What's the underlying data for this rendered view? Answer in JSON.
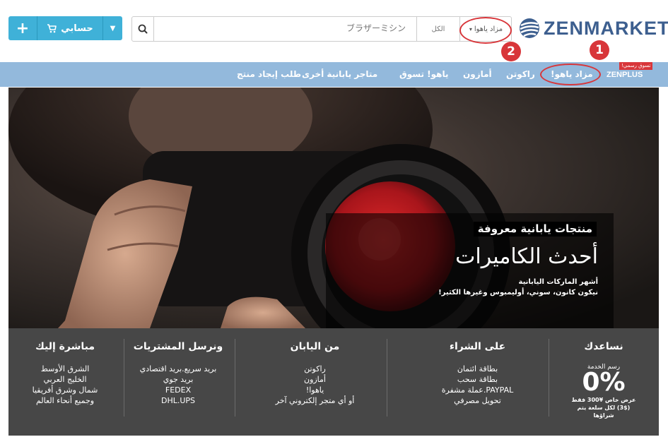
{
  "brand": {
    "name": "ZENMARKET"
  },
  "search": {
    "placeholder": "ブラザーミシン",
    "category": "الكل",
    "site": "مزاد ياهوا",
    "search_icon": "search-icon"
  },
  "account": {
    "label": "حسابي",
    "plus": "+",
    "cart_icon": "cart-icon",
    "caret_icon": "caret-down-icon"
  },
  "annotations": {
    "one": "1",
    "two": "2"
  },
  "nav": {
    "zenplus": "ZENPLUS",
    "zenplus_badge": "تسوق رسمي!",
    "items": [
      "مزاد ياهو!",
      "راكوتن",
      "أمازون",
      "ياهو! تسوق",
      "متاجر يابانية أخرى",
      "طلب إيجاد منتج"
    ]
  },
  "hero": {
    "subtitle": "منتجات يابانية معروفة",
    "title": "أحدث الكاميرات",
    "desc_line1": "أشهر الماركات اليابانية",
    "desc_line2": "نيكون كانون، سوني، أوليمبوس وغيرها الكثير!"
  },
  "footer": {
    "help": {
      "title": "نساعدك",
      "fee_label": "رسم الخدمة",
      "fee_value": "0%",
      "fee_desc": "عرض خاص ¥300 فقط ($3) لكل سلعة يتم شراؤها"
    },
    "buy": {
      "title": "على الشراء",
      "lines": [
        "بطاقة ائتمان",
        "بطاقة سحب",
        "PAYPAL.عملة مشفرة",
        "تحويل مصرفي"
      ]
    },
    "from_japan": {
      "title": "من اليابان",
      "lines": [
        "راكوتن",
        "أمازون",
        "ياهوا!",
        "أو أي متجر إلكتروني آخر"
      ]
    },
    "ship": {
      "title": "ونرسل المشتريات",
      "lines": [
        "بريد سريع.بريد اقتصادي",
        "بريد جوي",
        "FEDEX",
        "DHL.UPS"
      ]
    },
    "direct": {
      "title": "مباشرة إليك",
      "lines": [
        "الشرق الأوسط",
        "الخليج العربي",
        "شمال وشرق أفريقيا",
        "وجميع أنحاء العالم"
      ]
    }
  },
  "colors": {
    "nav_bg": "#93b9dc",
    "button_blue": "#3fb1d8",
    "annotation_red": "#d8363a",
    "footer_bg": "#474747",
    "logo_blue": "#3d5f8f"
  }
}
